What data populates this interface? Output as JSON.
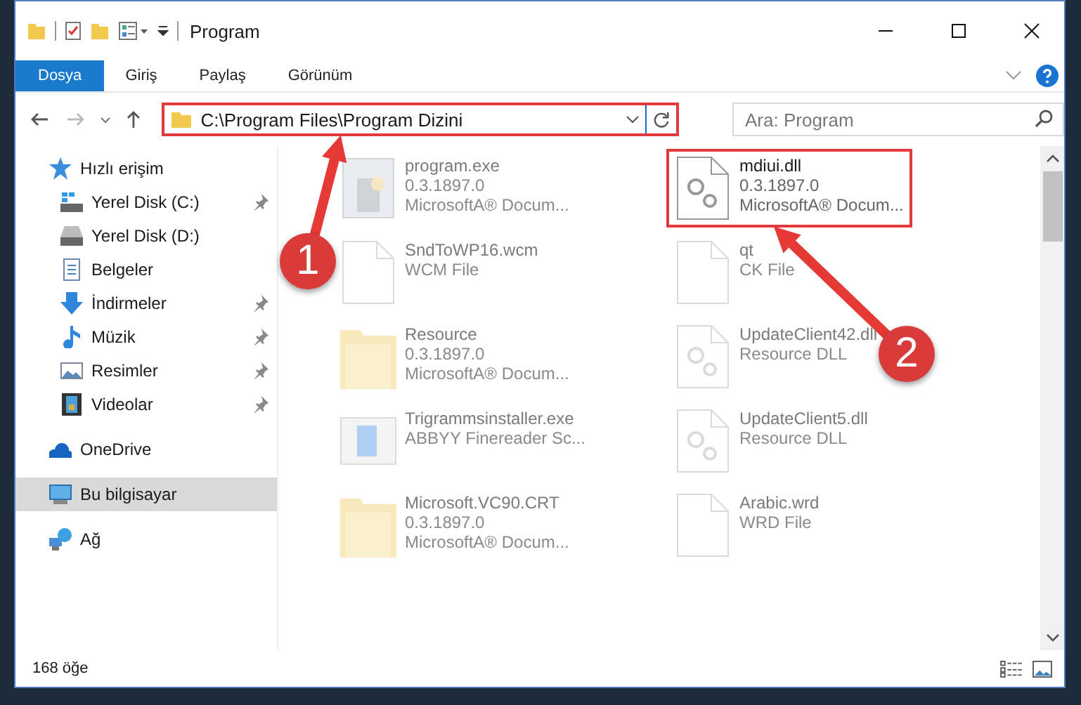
{
  "window": {
    "title": "Program"
  },
  "ribbon": {
    "tabs": [
      {
        "label": "Dosya",
        "selected": true
      },
      {
        "label": "Giriş",
        "selected": false
      },
      {
        "label": "Paylaş",
        "selected": false
      },
      {
        "label": "Görünüm",
        "selected": false
      }
    ]
  },
  "address": {
    "path": "C:\\Program Files\\Program Dizini",
    "highlighted": true
  },
  "search": {
    "placeholder": "Ara: Program"
  },
  "sidebar": {
    "items": [
      {
        "label": "Hızlı erişim",
        "kind": "star",
        "selected": false,
        "children": [
          {
            "label": "Yerel Disk (C:)",
            "kind": "drive-c",
            "pinned": true,
            "selected": false
          },
          {
            "label": "Yerel Disk (D:)",
            "kind": "drive",
            "pinned": false,
            "selected": false
          },
          {
            "label": "Belgeler",
            "kind": "document",
            "pinned": false,
            "selected": false
          },
          {
            "label": "İndirmeler",
            "kind": "download",
            "pinned": true,
            "selected": false
          },
          {
            "label": "Müzik",
            "kind": "music",
            "pinned": true,
            "selected": false
          },
          {
            "label": "Resimler",
            "kind": "pictures",
            "pinned": true,
            "selected": false
          },
          {
            "label": "Videolar",
            "kind": "video",
            "pinned": true,
            "selected": false
          }
        ]
      },
      {
        "label": "OneDrive",
        "kind": "cloud",
        "selected": false
      },
      {
        "label": "Bu bilgisayar",
        "kind": "computer",
        "selected": true
      },
      {
        "label": "Ağ",
        "kind": "network",
        "selected": false
      }
    ]
  },
  "files": [
    {
      "kind": "exe",
      "name": "program.exe",
      "lines": [
        "0.3.1897.0",
        "MicrosoftA® Docum..."
      ],
      "blurred": true,
      "highlighted": false
    },
    {
      "kind": "dll",
      "name": "mdiui.dll",
      "lines": [
        "0.3.1897.0",
        "MicrosoftA® Docum..."
      ],
      "blurred": false,
      "highlighted": true
    },
    {
      "kind": "blank",
      "name": "SndToWP16.wcm",
      "lines": [
        "WCM File"
      ],
      "blurred": true,
      "highlighted": false
    },
    {
      "kind": "blank",
      "name": "qt",
      "lines": [
        "CK File"
      ],
      "blurred": true,
      "highlighted": false
    },
    {
      "kind": "folder",
      "name": "Resource",
      "lines": [
        "0.3.1897.0",
        "MicrosoftA® Docum..."
      ],
      "blurred": true,
      "highlighted": false
    },
    {
      "kind": "dll",
      "name": "UpdateClient42.dll",
      "lines": [
        "Resource DLL"
      ],
      "blurred": true,
      "highlighted": false
    },
    {
      "kind": "installer",
      "name": "Trigrammsinstaller.exe",
      "lines": [
        "ABBYY Finereader Sc..."
      ],
      "blurred": true,
      "highlighted": false
    },
    {
      "kind": "dll",
      "name": "UpdateClient5.dll",
      "lines": [
        "Resource DLL"
      ],
      "blurred": true,
      "highlighted": false
    },
    {
      "kind": "folder",
      "name": "Microsoft.VC90.CRT",
      "lines": [
        "0.3.1897.0",
        "MicrosoftA® Docum..."
      ],
      "blurred": true,
      "highlighted": false
    },
    {
      "kind": "blank",
      "name": "Arabic.wrd",
      "lines": [
        "WRD File"
      ],
      "blurred": true,
      "highlighted": false
    }
  ],
  "status_bar": {
    "count": "168 öğe"
  },
  "annotations": [
    {
      "number": "1"
    },
    {
      "number": "2"
    }
  ]
}
